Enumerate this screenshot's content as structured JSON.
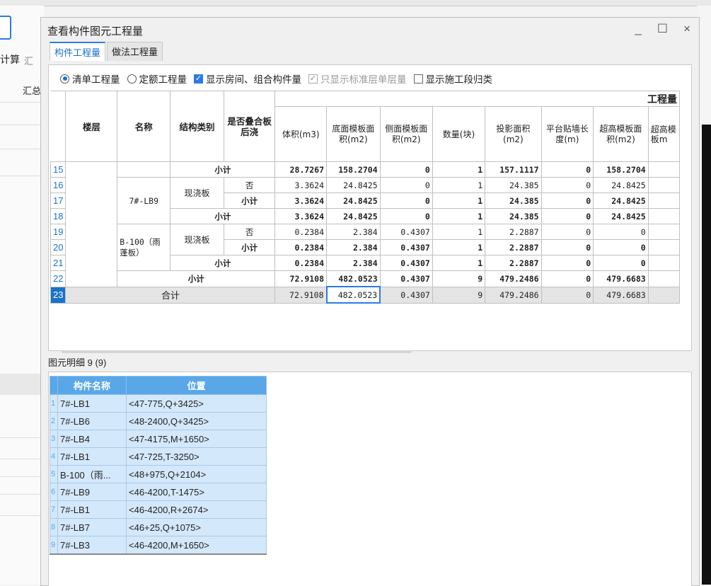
{
  "window": {
    "title": "查看构件图元工程量",
    "minimize": "_",
    "maximize": "☐",
    "close": "×"
  },
  "background": {
    "left_label_1": "计算",
    "left_label_2": "汇",
    "left_label_3": "汇总"
  },
  "tabs": [
    {
      "label": "构件工程量",
      "active": true
    },
    {
      "label": "做法工程量",
      "active": false
    }
  ],
  "options": {
    "radio_list": "清单工程量",
    "radio_quota": "定额工程量",
    "chk_show_room": "显示房间、组合构件量",
    "chk_std_floor": "只显示标准层单层量",
    "chk_construction": "显示施工段归类"
  },
  "grid": {
    "group_header": "工程量",
    "headers": {
      "floor": "楼层",
      "name": "名称",
      "struct": "结构类别",
      "overlay": "是否叠合板后浇",
      "vol": "体积(m3)",
      "bottom_form": "底面模板面积(m2)",
      "side_form": "侧面模板面积(m2)",
      "qty": "数量(块)",
      "proj_area": "投影面积(m2)",
      "wall_len": "平台贴墙长度(m)",
      "super_form": "超高模板面积(m2)",
      "super_form2": "超高模板m"
    },
    "rows": [
      {
        "rn": "15",
        "name": "",
        "struct": "小计",
        "overlay": "",
        "vol": "28.7267",
        "bottom": "158.2704",
        "side": "0",
        "qty": "1",
        "proj": "157.1117",
        "wall": "0",
        "super": "158.2704",
        "bold": true
      },
      {
        "rn": "16",
        "name": "7#-LB9",
        "struct": "现浇板",
        "overlay": "否",
        "vol": "3.3624",
        "bottom": "24.8425",
        "side": "0",
        "qty": "1",
        "proj": "24.385",
        "wall": "0",
        "super": "24.8425",
        "bold": false
      },
      {
        "rn": "17",
        "name": "",
        "struct": "",
        "overlay": "小计",
        "vol": "3.3624",
        "bottom": "24.8425",
        "side": "0",
        "qty": "1",
        "proj": "24.385",
        "wall": "0",
        "super": "24.8425",
        "bold": true
      },
      {
        "rn": "18",
        "name": "",
        "struct": "小计",
        "overlay": "",
        "vol": "3.3624",
        "bottom": "24.8425",
        "side": "0",
        "qty": "1",
        "proj": "24.385",
        "wall": "0",
        "super": "24.8425",
        "bold": true
      },
      {
        "rn": "19",
        "name": "B-100（雨蓬板）",
        "struct": "现浇板",
        "overlay": "否",
        "vol": "0.2384",
        "bottom": "2.384",
        "side": "0.4307",
        "qty": "1",
        "proj": "2.2887",
        "wall": "0",
        "super": "0",
        "bold": false
      },
      {
        "rn": "20",
        "name": "",
        "struct": "",
        "overlay": "小计",
        "vol": "0.2384",
        "bottom": "2.384",
        "side": "0.4307",
        "qty": "1",
        "proj": "2.2887",
        "wall": "0",
        "super": "0",
        "bold": true
      },
      {
        "rn": "21",
        "name": "",
        "struct": "小计",
        "overlay": "",
        "vol": "0.2384",
        "bottom": "2.384",
        "side": "0.4307",
        "qty": "1",
        "proj": "2.2887",
        "wall": "0",
        "super": "0",
        "bold": true
      },
      {
        "rn": "22",
        "name": "小计",
        "struct": "",
        "overlay": "",
        "vol": "72.9108",
        "bottom": "482.0523",
        "side": "0.4307",
        "qty": "9",
        "proj": "479.2486",
        "wall": "0",
        "super": "479.6683",
        "bold": true
      }
    ],
    "total": {
      "rn": "23",
      "label": "合计",
      "vol": "72.9108",
      "bottom": "482.0523",
      "side": "0.4307",
      "qty": "9",
      "proj": "479.2486",
      "wall": "0",
      "super": "479.6683"
    }
  },
  "detail": {
    "label": "图元明细 9 (9)",
    "col_name": "构件名称",
    "col_pos": "位置",
    "rows": [
      {
        "rn": "1",
        "name": "7#-LB1",
        "pos": "<47-775,Q+3425>"
      },
      {
        "rn": "2",
        "name": "7#-LB6",
        "pos": "<48-2400,Q+3425>"
      },
      {
        "rn": "3",
        "name": "7#-LB4",
        "pos": "<47-4175,M+1650>"
      },
      {
        "rn": "4",
        "name": "7#-LB1",
        "pos": "<47-725,T-3250>"
      },
      {
        "rn": "5",
        "name": "B-100（雨...",
        "pos": "<48+975,Q+2104>"
      },
      {
        "rn": "6",
        "name": "7#-LB9",
        "pos": "<46-4200,T-1475>"
      },
      {
        "rn": "7",
        "name": "7#-LB1",
        "pos": "<46-4200,R+2674>"
      },
      {
        "rn": "8",
        "name": "7#-LB7",
        "pos": "<46+25,Q+1075>"
      },
      {
        "rn": "9",
        "name": "7#-LB3",
        "pos": "<46-4200,M+1650>"
      }
    ]
  }
}
